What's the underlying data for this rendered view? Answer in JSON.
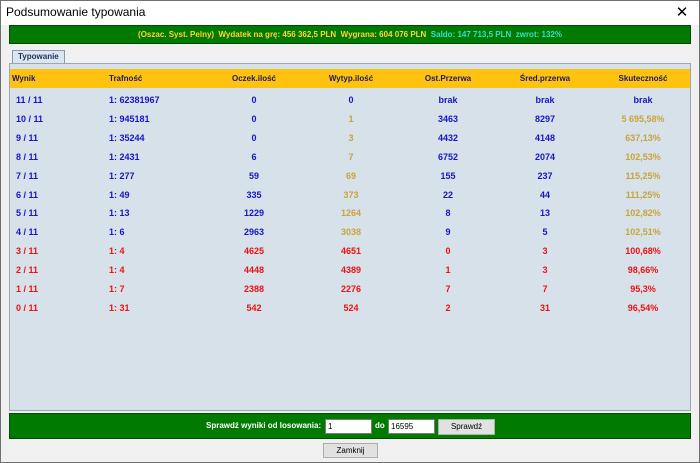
{
  "window": {
    "title": "Podsumowanie typowania",
    "close_glyph": "✕"
  },
  "summary": {
    "system": "(Oszac. Syst. Pelny)",
    "wydatek": "Wydatek na grę: 456 362,5 PLN",
    "wygrana": "Wygrana: 604 076 PLN",
    "saldo": "Saldo: 147 713,5 PLN",
    "zwrot": "zwrot: 132%"
  },
  "tab": {
    "label": "Typowanie"
  },
  "table": {
    "headers": [
      "Wynik",
      "Trafność",
      "Oczek.ilość",
      "Wytyp.ilość",
      "Ost.Przerwa",
      "Śred.przerwa",
      "Skuteczność"
    ],
    "rows": [
      {
        "wynik": "11 / 11",
        "trafnosc": "1: 62381967",
        "oczek": "0",
        "wytyp": "0",
        "ost": "brak",
        "sred": "brak",
        "skut": "brak",
        "color": "blue",
        "wytyp_color": "blue",
        "skut_color": "blue"
      },
      {
        "wynik": "10 / 11",
        "trafnosc": "1: 945181",
        "oczek": "0",
        "wytyp": "1",
        "ost": "3463",
        "sred": "8297",
        "skut": "5 695,58%",
        "color": "blue",
        "wytyp_color": "gold",
        "skut_color": "gold"
      },
      {
        "wynik": "9 / 11",
        "trafnosc": "1: 35244",
        "oczek": "0",
        "wytyp": "3",
        "ost": "4432",
        "sred": "4148",
        "skut": "637,13%",
        "color": "blue",
        "wytyp_color": "gold",
        "skut_color": "gold"
      },
      {
        "wynik": "8 / 11",
        "trafnosc": "1: 2431",
        "oczek": "6",
        "wytyp": "7",
        "ost": "6752",
        "sred": "2074",
        "skut": "102,53%",
        "color": "blue",
        "wytyp_color": "gold",
        "skut_color": "gold"
      },
      {
        "wynik": "7 / 11",
        "trafnosc": "1: 277",
        "oczek": "59",
        "wytyp": "69",
        "ost": "155",
        "sred": "237",
        "skut": "115,25%",
        "color": "blue",
        "wytyp_color": "gold",
        "skut_color": "gold"
      },
      {
        "wynik": "6 / 11",
        "trafnosc": "1: 49",
        "oczek": "335",
        "wytyp": "373",
        "ost": "22",
        "sred": "44",
        "skut": "111,25%",
        "color": "blue",
        "wytyp_color": "gold",
        "skut_color": "gold"
      },
      {
        "wynik": "5 / 11",
        "trafnosc": "1: 13",
        "oczek": "1229",
        "wytyp": "1264",
        "ost": "8",
        "sred": "13",
        "skut": "102,82%",
        "color": "blue",
        "wytyp_color": "gold",
        "skut_color": "gold"
      },
      {
        "wynik": "4 / 11",
        "trafnosc": "1: 6",
        "oczek": "2963",
        "wytyp": "3038",
        "ost": "9",
        "sred": "5",
        "skut": "102,51%",
        "color": "blue",
        "wytyp_color": "gold",
        "skut_color": "gold"
      },
      {
        "wynik": "3 / 11",
        "trafnosc": "1: 4",
        "oczek": "4625",
        "wytyp": "4651",
        "ost": "0",
        "sred": "3",
        "skut": "100,68%",
        "color": "red",
        "wytyp_color": "red",
        "skut_color": "red"
      },
      {
        "wynik": "2 / 11",
        "trafnosc": "1: 4",
        "oczek": "4448",
        "wytyp": "4389",
        "ost": "1",
        "sred": "3",
        "skut": "98,66%",
        "color": "red",
        "wytyp_color": "red",
        "skut_color": "red"
      },
      {
        "wynik": "1 / 11",
        "trafnosc": "1: 7",
        "oczek": "2388",
        "wytyp": "2276",
        "ost": "7",
        "sred": "7",
        "skut": "95,3%",
        "color": "red",
        "wytyp_color": "red",
        "skut_color": "red"
      },
      {
        "wynik": "0 / 11",
        "trafnosc": "1: 31",
        "oczek": "542",
        "wytyp": "524",
        "ost": "2",
        "sred": "31",
        "skut": "96,54%",
        "color": "red",
        "wytyp_color": "red",
        "skut_color": "red"
      }
    ]
  },
  "check": {
    "label": "Sprawdź wyniki od losowania:",
    "from_value": "1",
    "to_label": "do",
    "to_value": "16595",
    "button_label": "Sprawdź"
  },
  "close_button": {
    "label": "Zamknij"
  },
  "colors": {
    "summary_bg": "#007a00",
    "header_bg": "#ffc20e",
    "panel_bg": "#d6e1ea",
    "blue": "#1616c8",
    "gold": "#c8a43a",
    "red": "#ee1111"
  }
}
